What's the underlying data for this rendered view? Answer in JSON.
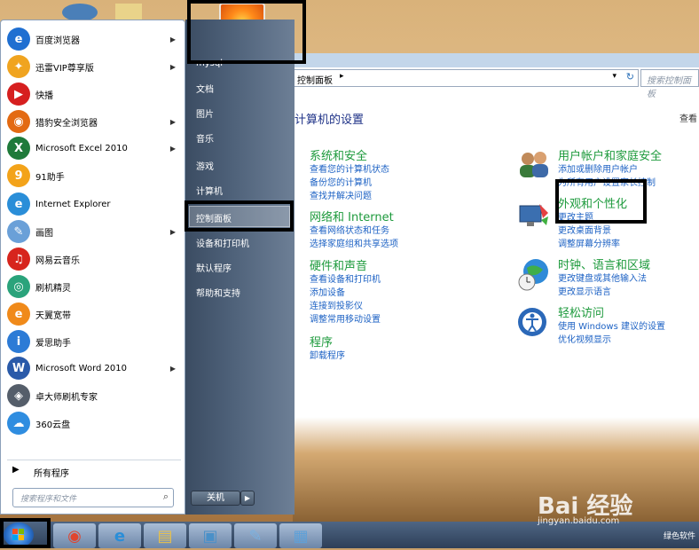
{
  "start_menu": {
    "programs": [
      {
        "label": "百度浏览器",
        "icon": "baidu-browser-icon",
        "color": "#1f6fd1",
        "glyph": "e",
        "arrow": true
      },
      {
        "label": "迅雷VIP尊享版",
        "icon": "xunlei-icon",
        "color": "#f0a420",
        "glyph": "✦",
        "arrow": true
      },
      {
        "label": "快播",
        "icon": "kuaibo-icon",
        "color": "#d61f1f",
        "glyph": "▶",
        "arrow": false
      },
      {
        "label": "猎豹安全浏览器",
        "icon": "liebao-browser-icon",
        "color": "#e36a12",
        "glyph": "◉",
        "arrow": true
      },
      {
        "label": "Microsoft Excel 2010",
        "icon": "excel-icon",
        "color": "#1f7a3a",
        "glyph": "X",
        "arrow": true
      },
      {
        "label": "91助手",
        "icon": "91-assistant-icon",
        "color": "#f3a31a",
        "glyph": "9",
        "arrow": false
      },
      {
        "label": "Internet Explorer",
        "icon": "internet-explorer-icon",
        "color": "#2a8ed8",
        "glyph": "e",
        "arrow": false
      },
      {
        "label": "画图",
        "icon": "paint-icon",
        "color": "#6aa0d8",
        "glyph": "✎",
        "arrow": true
      },
      {
        "label": "网易云音乐",
        "icon": "netease-music-icon",
        "color": "#d7251d",
        "glyph": "♫",
        "arrow": false
      },
      {
        "label": "刷机精灵",
        "icon": "shuaji-icon",
        "color": "#2aa37b",
        "glyph": "◎",
        "arrow": false
      },
      {
        "label": "天翼宽带",
        "icon": "tianyi-icon",
        "color": "#f08a1a",
        "glyph": "e",
        "arrow": false
      },
      {
        "label": "爱思助手",
        "icon": "aisi-icon",
        "color": "#2c7bd6",
        "glyph": "i",
        "arrow": false
      },
      {
        "label": "Microsoft Word 2010",
        "icon": "word-icon",
        "color": "#2a5aa9",
        "glyph": "W",
        "arrow": true
      },
      {
        "label": "卓大师刷机专家",
        "icon": "zhuodashi-icon",
        "color": "#555e6a",
        "glyph": "◈",
        "arrow": false
      },
      {
        "label": "360云盘",
        "icon": "360-cloud-icon",
        "color": "#2f8de0",
        "glyph": "☁",
        "arrow": false
      }
    ],
    "all_programs": "所有程序",
    "search_placeholder": "搜索程序和文件",
    "right_items": [
      "文档",
      "图片",
      "音乐",
      "游戏",
      "计算机",
      "控制面板",
      "设备和打印机",
      "默认程序",
      "帮助和支持"
    ],
    "user_name_partial": "mysql",
    "shutdown": "关机"
  },
  "control_panel": {
    "address": "控制面板",
    "search_placeholder": "搜索控制面板",
    "heading": "计算机的设置",
    "view_by": "查看",
    "categories_left": [
      {
        "title": "系统和安全",
        "icon": "shield-flag-icon",
        "links": [
          "查看您的计算机状态",
          "备份您的计算机",
          "查找并解决问题"
        ]
      },
      {
        "title": "网络和 Internet",
        "icon": "network-globe-icon",
        "links": [
          "查看网络状态和任务",
          "选择家庭组和共享选项"
        ]
      },
      {
        "title": "硬件和声音",
        "icon": "printer-speaker-icon",
        "links": [
          "查看设备和打印机",
          "添加设备",
          "连接到投影仪",
          "调整常用移动设置"
        ]
      },
      {
        "title": "程序",
        "icon": "programs-icon",
        "links": [
          "卸载程序"
        ]
      }
    ],
    "categories_right": [
      {
        "title": "用户帐户和家庭安全",
        "icon": "users-icon",
        "links": [
          "添加或删除用户帐户",
          "为所有用户设置家长控制"
        ]
      },
      {
        "title": "外观和个性化",
        "icon": "display-brush-icon",
        "links": [
          "更改主题",
          "更改桌面背景",
          "调整屏幕分辨率"
        ]
      },
      {
        "title": "时钟、语言和区域",
        "icon": "clock-globe-icon",
        "links": [
          "更改键盘或其他输入法",
          "更改显示语言"
        ]
      },
      {
        "title": "轻松访问",
        "icon": "ease-of-access-icon",
        "links": [
          "使用 Windows 建议的设置",
          "优化视频显示"
        ]
      }
    ]
  },
  "taskbar": {
    "buttons": [
      {
        "name": "chrome-icon",
        "glyph": "◉",
        "color": "#e0452f"
      },
      {
        "name": "ie-icon",
        "glyph": "e",
        "color": "#2a8ed8"
      },
      {
        "name": "file-explorer-icon",
        "glyph": "▤",
        "color": "#e8c04a"
      },
      {
        "name": "photo-viewer-icon",
        "glyph": "▣",
        "color": "#4a90c8"
      },
      {
        "name": "paint-icon",
        "glyph": "✎",
        "color": "#7ab0e0"
      },
      {
        "name": "control-panel-icon",
        "glyph": "▦",
        "color": "#5ea0d8"
      }
    ],
    "tray_text": "绿色软件"
  },
  "watermark": {
    "brand": "Bai 经验",
    "url": "jingyan.baidu.com"
  }
}
